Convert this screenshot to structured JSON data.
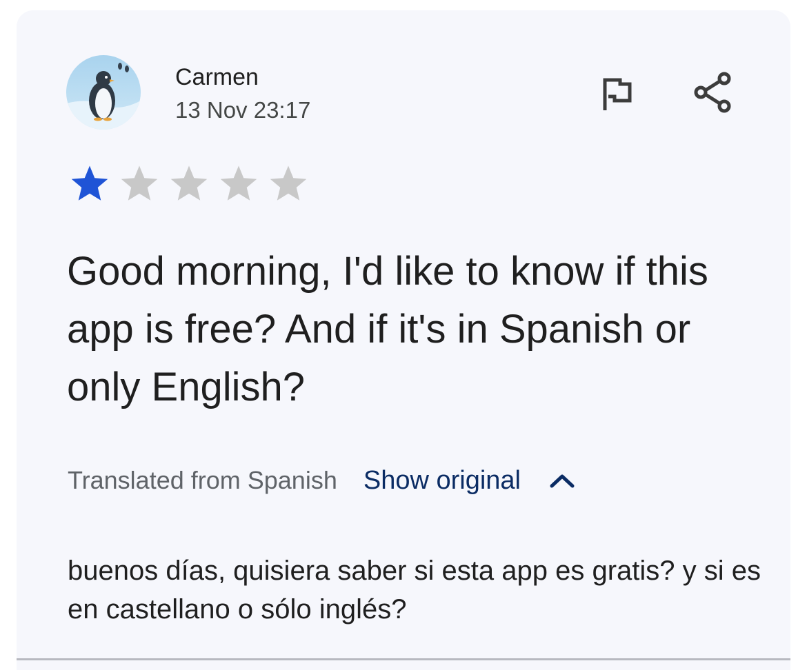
{
  "review": {
    "author": "Carmen",
    "timestamp": "13 Nov 23:17",
    "rating": 1,
    "rating_max": 5,
    "text": "Good morning, I'd like to know if this app is free? And if it's in Spanish or only English?",
    "translation_label": "Translated from Spanish",
    "show_original_label": "Show original",
    "original_text": "buenos días, quisiera saber si esta app es gratis? y si es en castellano o sólo inglés?"
  },
  "icons": {
    "avatar": "penguin-avatar",
    "report": "flag-icon",
    "share": "share-icon",
    "collapse": "chevron-up-icon",
    "rating": "star-icon"
  },
  "colors": {
    "card_background": "#f6f7fc",
    "star_filled": "#1f54d6",
    "star_empty": "#c8c8c8",
    "link": "#0b2c64",
    "primary_text": "#1f1f1f",
    "secondary_text": "#5f6368"
  }
}
